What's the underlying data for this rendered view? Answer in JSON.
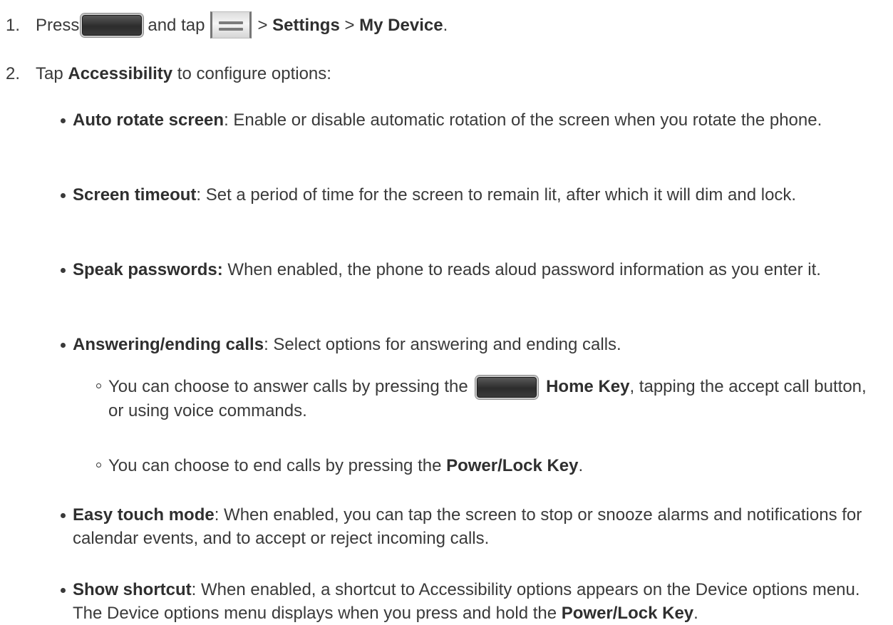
{
  "steps": [
    {
      "number": "1.",
      "press": "Press",
      "and_tap": "and tap",
      "sep1": ">",
      "settings": "Settings",
      "sep2": ">",
      "my_device": "My Device",
      "period": "."
    },
    {
      "number": "2.",
      "tap": "Tap",
      "accessibility": "Accessibility",
      "rest": "to configure options:"
    }
  ],
  "options": {
    "auto_rotate": {
      "title": "Auto rotate screen",
      "desc": ": Enable or disable automatic rotation of the screen when you rotate the phone."
    },
    "screen_timeout": {
      "title": "Screen timeout",
      "desc": ": Set a period of time for the screen to remain lit, after which it will dim and lock."
    },
    "speak_passwords": {
      "title": "Speak passwords:",
      "desc": " When enabled, the phone to reads aloud password information as you enter it."
    },
    "answering": {
      "title": "Answering/ending calls",
      "desc": ": Select options for answering and ending calls.",
      "sub1_pre": "You can choose to answer calls by pressing the",
      "sub1_key": "Home Key",
      "sub1_post": ", tapping the accept call button, or using voice commands.",
      "sub2_pre": "You can choose to end calls by pressing the ",
      "sub2_key": "Power/Lock Key",
      "sub2_post": "."
    },
    "easy_touch": {
      "title": "Easy touch mode",
      "desc": ": When enabled, you can tap the screen to stop or snooze alarms and notifications for calendar events, and to accept or reject incoming calls."
    },
    "show_shortcut": {
      "title": "Show shortcut",
      "desc": ": When enabled, a shortcut to Accessibility options appears on the Device options menu. The Device options menu displays when you press and hold the ",
      "key": "Power/Lock Key",
      "end": "."
    }
  },
  "icons": {
    "home_key": "home-key-icon",
    "menu_key": "menu-key-icon"
  }
}
